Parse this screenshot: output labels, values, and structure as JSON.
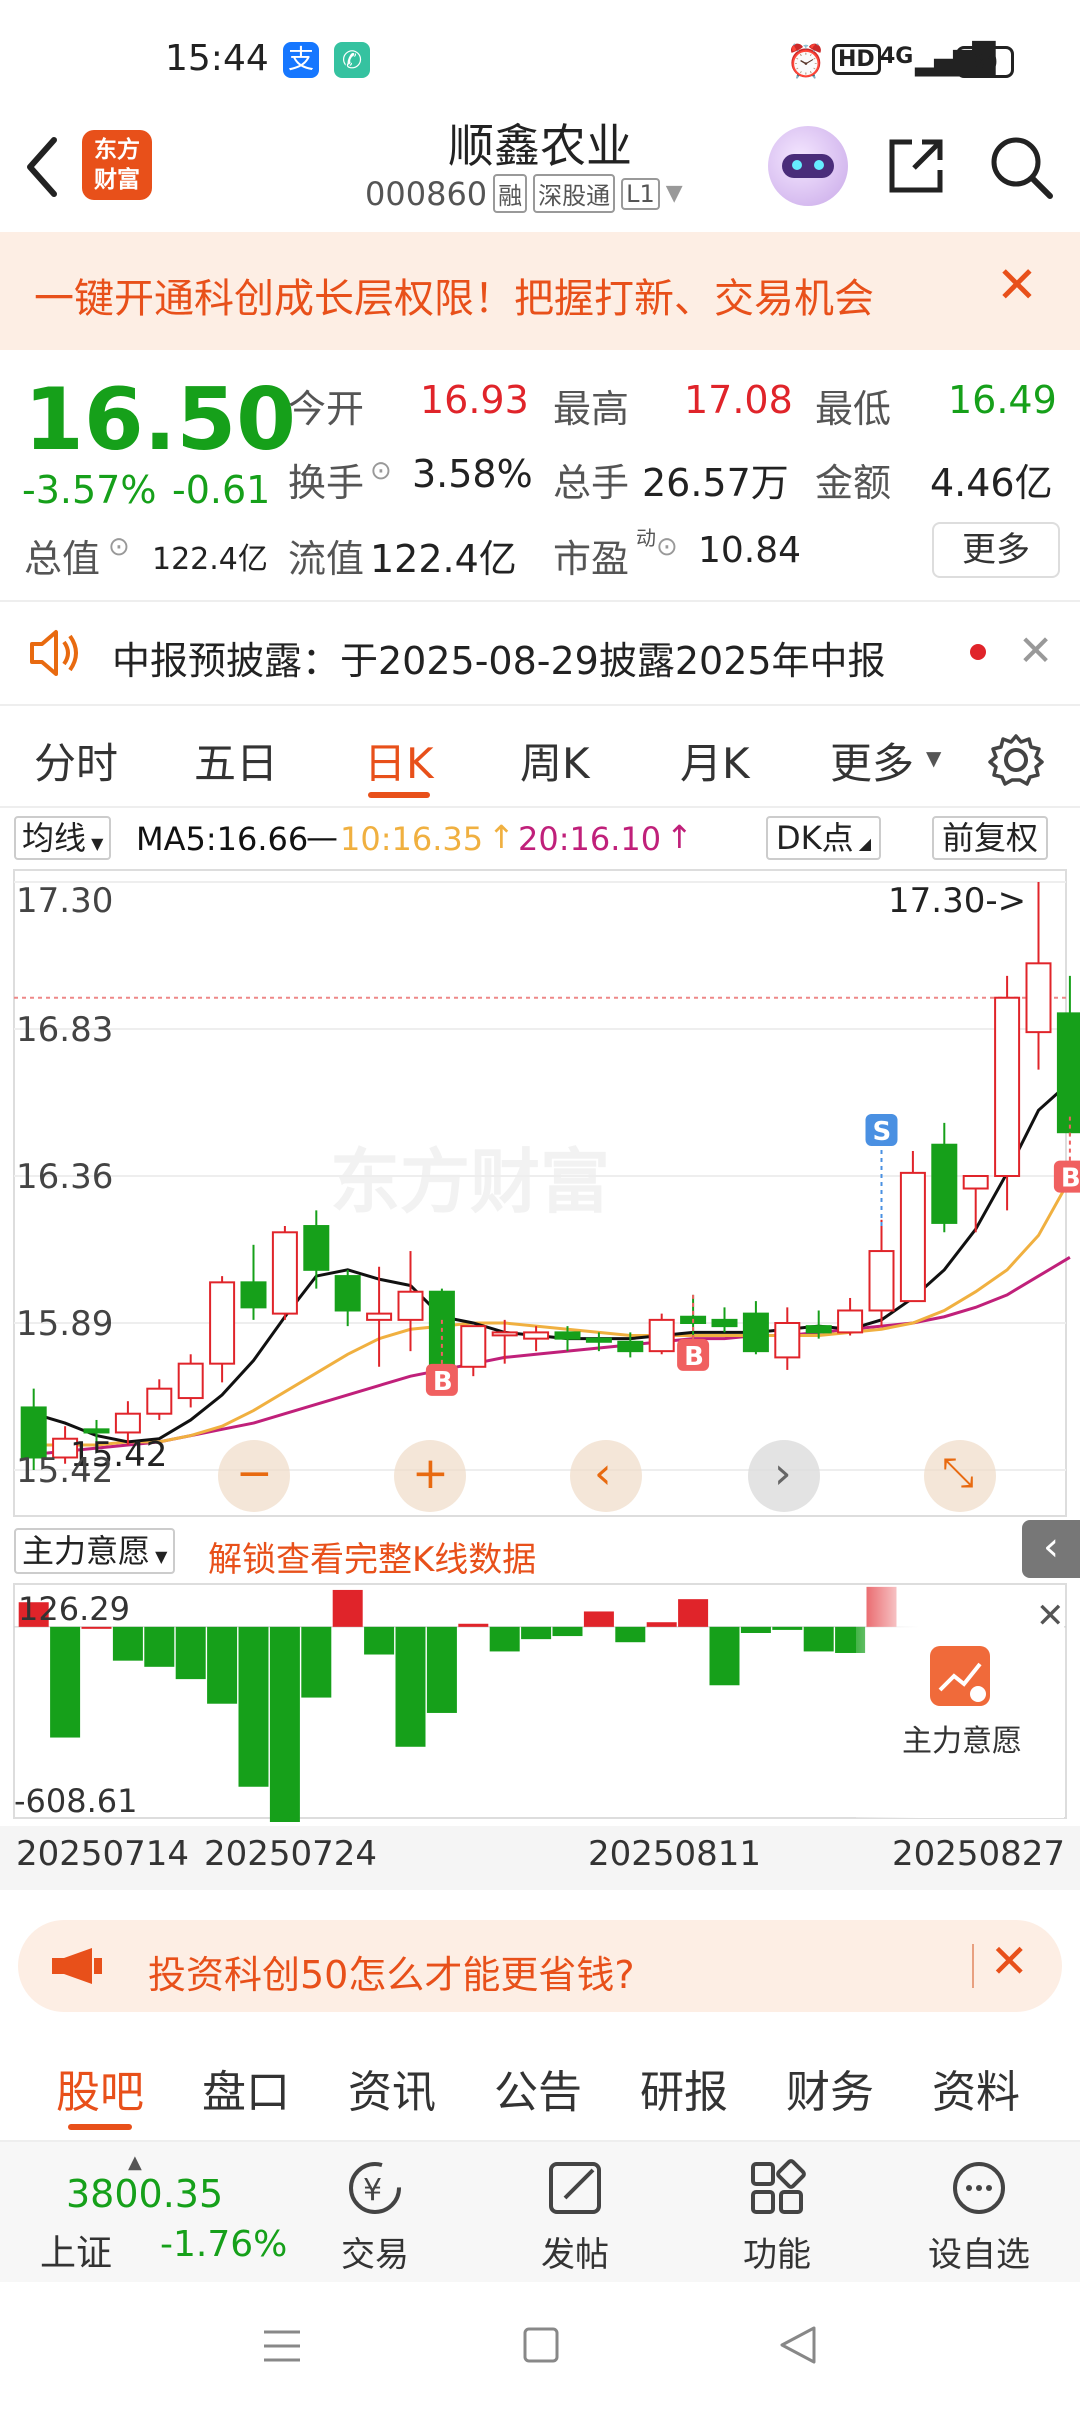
{
  "status": {
    "time": "15:44",
    "network": "4G",
    "battery": "80"
  },
  "header": {
    "logo_line1": "东方",
    "logo_line2": "财富",
    "title": "顺鑫农业",
    "code": "000860",
    "tags": [
      "融",
      "深股通",
      "L1"
    ]
  },
  "banner": {
    "text": "一键开通科创成长层权限！把握打新、交易机会"
  },
  "quote": {
    "price": "16.50",
    "change_pct": "-3.57%",
    "change": "-0.61",
    "open_label": "今开",
    "open": "16.93",
    "high_label": "最高",
    "high": "17.08",
    "low_label": "最低",
    "low": "16.49",
    "turnover_label": "换手",
    "turnover": "3.58%",
    "volume_label": "总手",
    "volume": "26.57万",
    "amount_label": "金额",
    "amount": "4.46亿",
    "mcap_label": "总值",
    "mcap": "122.4亿",
    "float_label": "流值",
    "float": "122.4亿",
    "pe_label": "市盈",
    "pe_sup": "动",
    "pe": "10.84",
    "more": "更多"
  },
  "notice": {
    "text": "中报预披露：于2025-08-29披露2025年中报"
  },
  "chart_tabs": [
    "分时",
    "五日",
    "日K",
    "周K",
    "月K",
    "更多"
  ],
  "ma_bar": {
    "label": "均线",
    "ma5": "MA5:16.66",
    "ma10": "10:16.35",
    "ma20": "20:16.10",
    "dk": "DK点",
    "fq": "前复权"
  },
  "chart_data": {
    "type": "candlestick",
    "y_ticks": [
      "17.30",
      "16.83",
      "16.36",
      "15.89",
      "15.42"
    ],
    "ylim": [
      15.42,
      17.3
    ],
    "max_label": "17.30->",
    "min_label": "15.42",
    "x_labels": [
      "20250714",
      "20250724",
      "20250811",
      "20250827"
    ],
    "candles": [
      {
        "o": 15.62,
        "c": 15.46,
        "h": 15.68,
        "l": 15.42
      },
      {
        "o": 15.46,
        "c": 15.52,
        "h": 15.56,
        "l": 15.44
      },
      {
        "o": 15.55,
        "c": 15.54,
        "h": 15.58,
        "l": 15.5
      },
      {
        "o": 15.54,
        "c": 15.6,
        "h": 15.64,
        "l": 15.5
      },
      {
        "o": 15.6,
        "c": 15.68,
        "h": 15.71,
        "l": 15.58
      },
      {
        "o": 15.65,
        "c": 15.76,
        "h": 15.79,
        "l": 15.62
      },
      {
        "o": 15.76,
        "c": 16.02,
        "h": 16.04,
        "l": 15.7
      },
      {
        "o": 16.02,
        "c": 15.94,
        "h": 16.14,
        "l": 15.9
      },
      {
        "o": 15.92,
        "c": 16.18,
        "h": 16.2,
        "l": 15.9
      },
      {
        "o": 16.2,
        "c": 16.06,
        "h": 16.25,
        "l": 16.0
      },
      {
        "o": 16.04,
        "c": 15.93,
        "h": 16.06,
        "l": 15.88
      },
      {
        "o": 15.9,
        "c": 15.92,
        "h": 16.07,
        "l": 15.75
      },
      {
        "o": 15.9,
        "c": 15.99,
        "h": 16.12,
        "l": 15.8
      },
      {
        "o": 15.99,
        "c": 15.75,
        "h": 16.0,
        "l": 15.72
      },
      {
        "o": 15.75,
        "c": 15.88,
        "h": 15.88,
        "l": 15.72
      },
      {
        "o": 15.86,
        "c": 15.86,
        "h": 15.9,
        "l": 15.76
      },
      {
        "o": 15.84,
        "c": 15.86,
        "h": 15.88,
        "l": 15.8
      },
      {
        "o": 15.86,
        "c": 15.84,
        "h": 15.88,
        "l": 15.8
      },
      {
        "o": 15.84,
        "c": 15.83,
        "h": 15.86,
        "l": 15.8
      },
      {
        "o": 15.83,
        "c": 15.8,
        "h": 15.86,
        "l": 15.78
      },
      {
        "o": 15.8,
        "c": 15.9,
        "h": 15.92,
        "l": 15.79
      },
      {
        "o": 15.91,
        "c": 15.89,
        "h": 15.98,
        "l": 15.82
      },
      {
        "o": 15.9,
        "c": 15.88,
        "h": 15.94,
        "l": 15.86
      },
      {
        "o": 15.92,
        "c": 15.8,
        "h": 15.96,
        "l": 15.79
      },
      {
        "o": 15.78,
        "c": 15.89,
        "h": 15.94,
        "l": 15.74
      },
      {
        "o": 15.88,
        "c": 15.86,
        "h": 15.93,
        "l": 15.84
      },
      {
        "o": 15.86,
        "c": 15.93,
        "h": 15.97,
        "l": 15.85
      },
      {
        "o": 15.93,
        "c": 16.12,
        "h": 16.22,
        "l": 15.88
      },
      {
        "o": 15.96,
        "c": 16.37,
        "h": 16.44,
        "l": 15.96
      },
      {
        "o": 16.46,
        "c": 16.21,
        "h": 16.53,
        "l": 16.18
      },
      {
        "o": 16.32,
        "c": 16.36,
        "h": 16.36,
        "l": 16.18
      },
      {
        "o": 16.36,
        "c": 16.93,
        "h": 17.0,
        "l": 16.25
      },
      {
        "o": 16.82,
        "c": 17.04,
        "h": 17.3,
        "l": 16.7
      },
      {
        "o": 16.88,
        "c": 16.5,
        "h": 17.0,
        "l": 16.49
      }
    ],
    "ma5": [
      15.6,
      15.57,
      15.53,
      15.51,
      15.52,
      15.58,
      15.66,
      15.77,
      15.91,
      16.04,
      16.06,
      16.03,
      16.01,
      15.91,
      15.89,
      15.86,
      15.85,
      15.84,
      15.84,
      15.84,
      15.85,
      15.86,
      15.86,
      15.86,
      15.87,
      15.88,
      15.87,
      15.9,
      15.97,
      16.06,
      16.19,
      16.37,
      16.57,
      16.66
    ],
    "ma10": [
      15.5,
      15.5,
      15.5,
      15.51,
      15.51,
      15.53,
      15.56,
      15.61,
      15.67,
      15.73,
      15.79,
      15.84,
      15.87,
      15.88,
      15.89,
      15.89,
      15.88,
      15.87,
      15.86,
      15.85,
      15.85,
      15.85,
      15.85,
      15.85,
      15.85,
      15.85,
      15.86,
      15.87,
      15.89,
      15.93,
      15.99,
      16.06,
      16.17,
      16.35
    ],
    "ma20": [
      15.47,
      15.48,
      15.49,
      15.5,
      15.51,
      15.53,
      15.55,
      15.57,
      15.6,
      15.63,
      15.66,
      15.69,
      15.72,
      15.74,
      15.76,
      15.78,
      15.79,
      15.8,
      15.81,
      15.82,
      15.83,
      15.84,
      15.84,
      15.85,
      15.85,
      15.86,
      15.87,
      15.88,
      15.89,
      15.91,
      15.94,
      15.98,
      16.04,
      16.1
    ],
    "sub_indicator": {
      "name": "主力意愿",
      "locked_text": "解锁查看完整K线数据",
      "ylim": [
        -608.61,
        126.29
      ],
      "top_label": "126.29",
      "bottom_label": "-608.61",
      "values": [
        80,
        -360,
        0,
        -110,
        -130,
        -170,
        -250,
        -520,
        -720,
        -230,
        120,
        -90,
        -390,
        -280,
        10,
        -80,
        -40,
        -30,
        50,
        -50,
        15,
        90,
        -190,
        -20,
        -10,
        -80,
        -85,
        130
      ]
    },
    "markers": {
      "s": "S",
      "b": "B"
    }
  },
  "locked_badge": "主力意愿",
  "promo": {
    "text": "投资科创50怎么才能更省钱?"
  },
  "bottom_tabs": [
    "股吧",
    "盘口",
    "资讯",
    "公告",
    "研报",
    "财务",
    "资料"
  ],
  "nav": {
    "index_value": "3800.35",
    "index_name": "上证",
    "index_change": "-1.76%",
    "items": [
      "交易",
      "发帖",
      "功能",
      "设自选"
    ]
  },
  "colors": {
    "up": "#e0242a",
    "down": "#16a01a",
    "accent": "#e86a10",
    "ma5": "#111111",
    "ma10": "#f0b040",
    "ma20": "#c0207a"
  }
}
